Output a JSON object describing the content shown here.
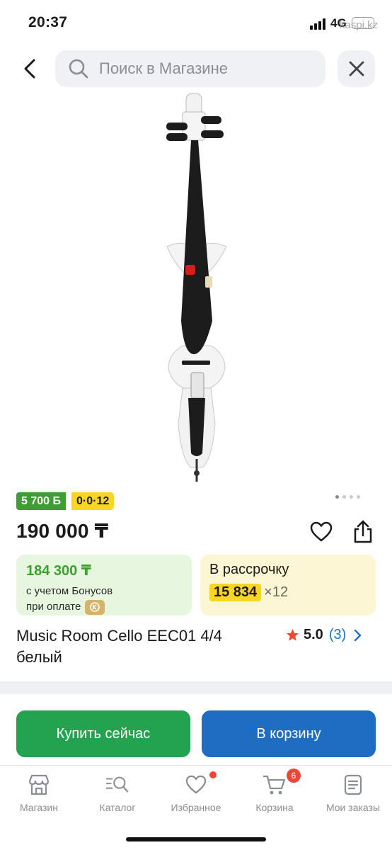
{
  "status_bar": {
    "time": "20:37",
    "network": "4G",
    "url": "kaspi.kz"
  },
  "search": {
    "placeholder": "Поиск в Магазине"
  },
  "gallery": {
    "image_count": 4,
    "active_index": 0
  },
  "badges": {
    "bonus": "5 700 Б",
    "installment": "0·0·12"
  },
  "product": {
    "price": "190 000 ₸",
    "title": "Music Room Cello EEC01 4/4 белый",
    "rating": "5.0",
    "reviews": "(3)"
  },
  "bonus_card": {
    "price": "184 300 ₸",
    "line1": "с учетом Бонусов",
    "line2": "при оплате"
  },
  "installment_card": {
    "title": "В рассрочку",
    "amount": "15 834",
    "term": "×12"
  },
  "actions": {
    "buy": "Купить сейчас",
    "cart": "В корзину"
  },
  "tabs": [
    {
      "label": "Магазин",
      "icon": "shop-icon"
    },
    {
      "label": "Каталог",
      "icon": "catalog-search-icon"
    },
    {
      "label": "Избранное",
      "icon": "heart-icon"
    },
    {
      "label": "Корзина",
      "icon": "cart-icon",
      "badge": "6"
    },
    {
      "label": "Мои заказы",
      "icon": "orders-icon"
    }
  ],
  "colors": {
    "green": "#23a34f",
    "blue": "#1f6dc2",
    "yellow": "#f9d624",
    "badge_red": "#f14635",
    "link_blue": "#1f72c8"
  }
}
